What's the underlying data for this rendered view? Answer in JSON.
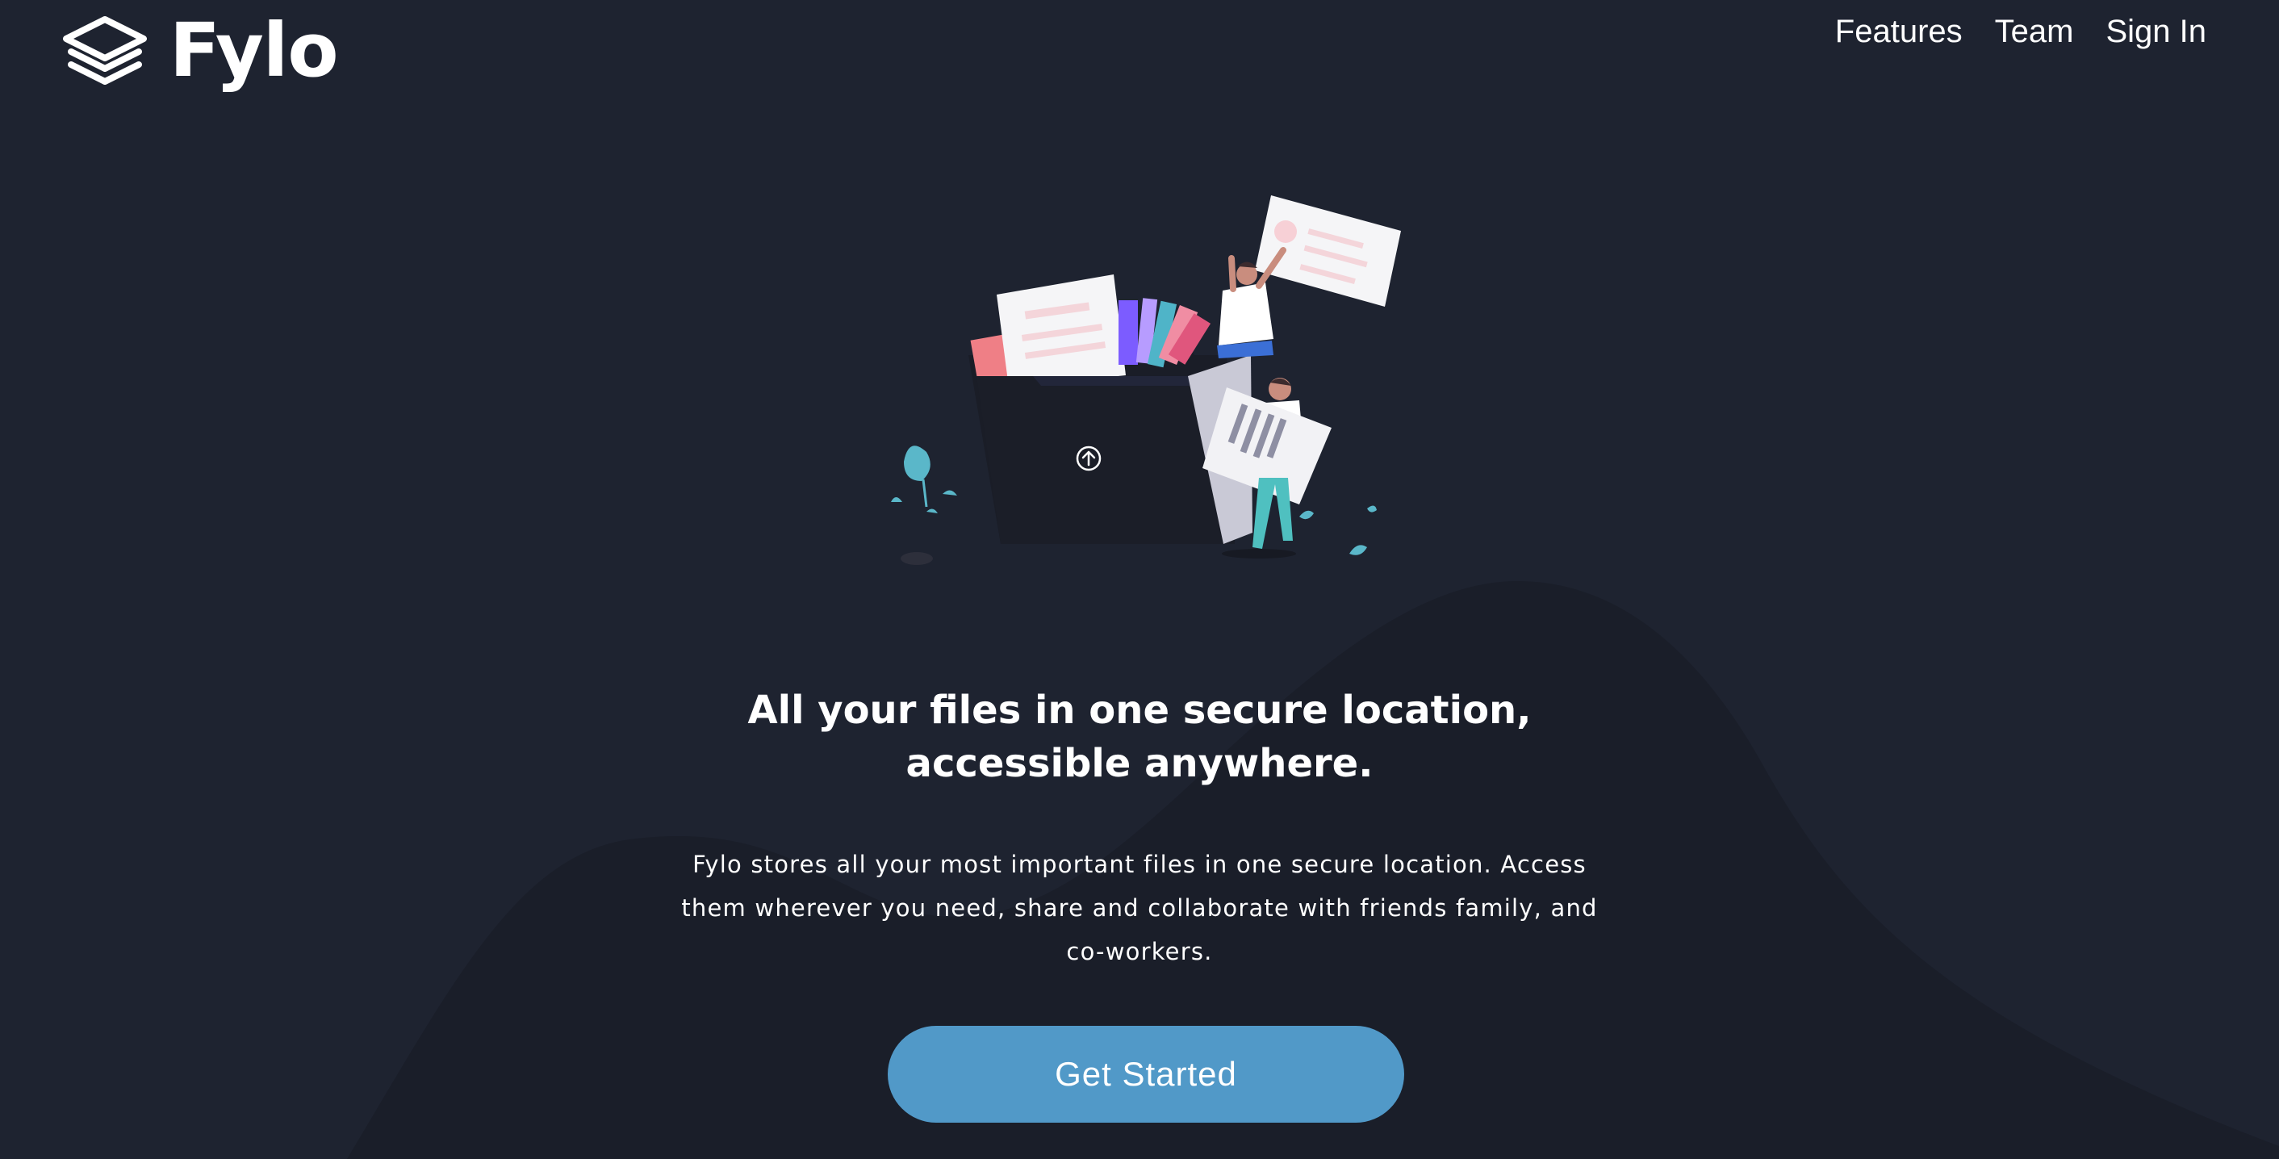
{
  "brand": {
    "name": "Fylo",
    "icon": "layers-logo-icon"
  },
  "nav": {
    "items": [
      {
        "label": "Features"
      },
      {
        "label": "Team"
      },
      {
        "label": "Sign In"
      }
    ]
  },
  "hero": {
    "illustration": "file-sharing-illustration",
    "headline_line1": "All your files in one secure location,",
    "headline_line2": "accessible anywhere.",
    "description": "Fylo stores all your most important files in one secure location. Access them wherever you need, share and collaborate with friends family, and co-workers.",
    "cta_label": "Get Started"
  },
  "colors": {
    "background": "#1e2330",
    "accent": "#5199c8",
    "text": "#ffffff"
  }
}
